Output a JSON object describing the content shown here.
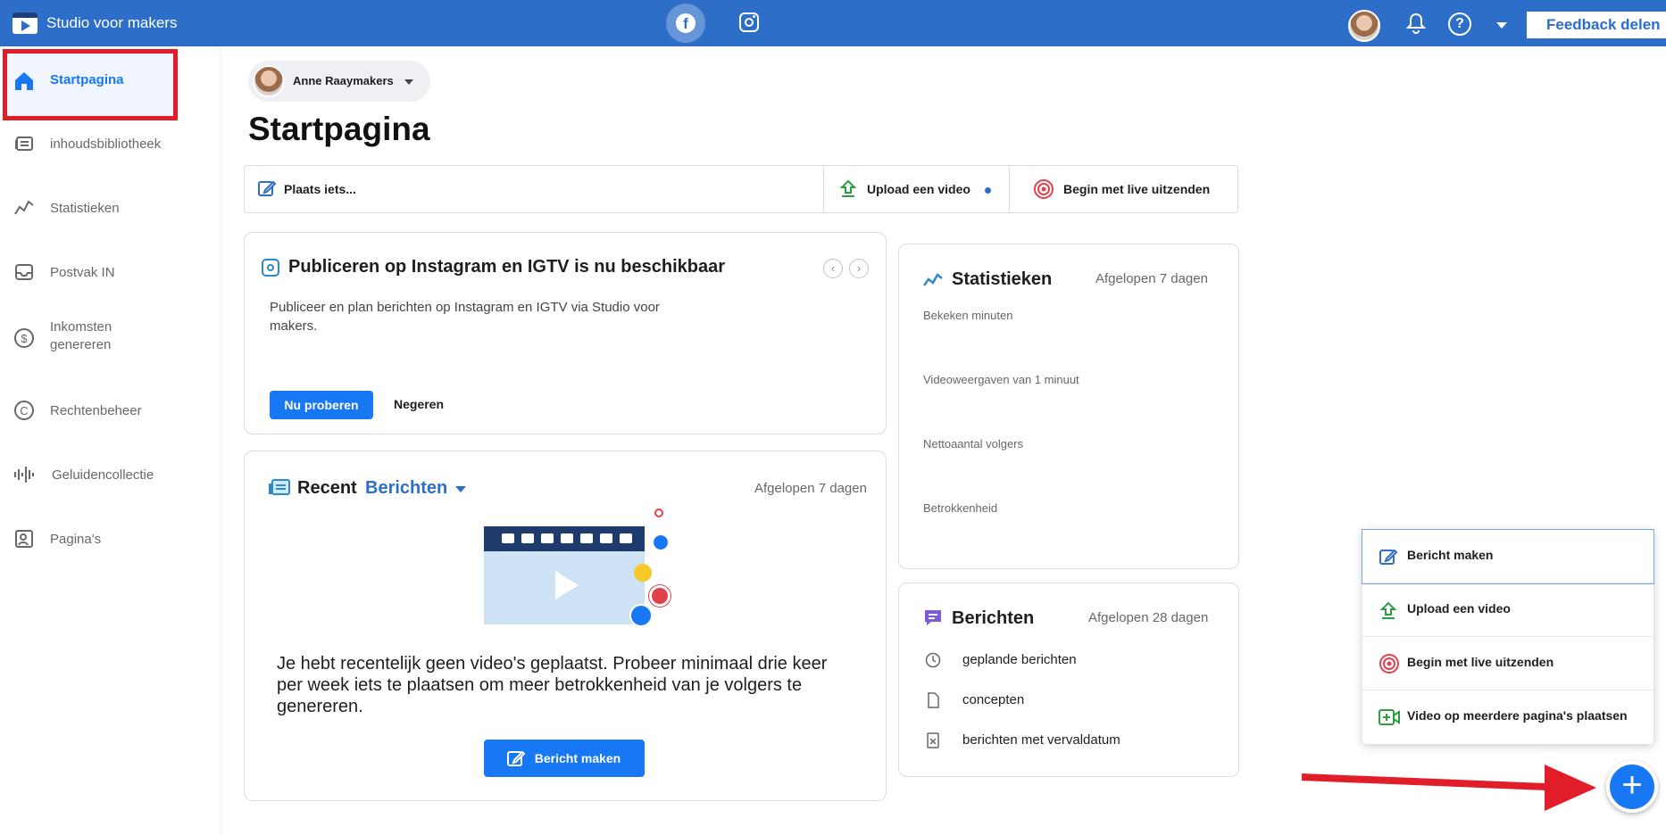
{
  "topbar": {
    "app_title": "Studio voor makers",
    "platforms": [
      "facebook",
      "instagram"
    ],
    "feedback_label": "Feedback delen"
  },
  "sidebar": {
    "items": [
      {
        "label": "Startpagina",
        "icon": "home-icon",
        "active": true
      },
      {
        "label": "inhoudsbibliotheek",
        "icon": "library-icon"
      },
      {
        "label": "Statistieken",
        "icon": "stats-icon"
      },
      {
        "label": "Postvak IN",
        "icon": "inbox-icon"
      },
      {
        "label": "Inkomsten genereren",
        "icon": "dollar-icon"
      },
      {
        "label": "Rechtenbeheer",
        "icon": "copyright-icon"
      },
      {
        "label": "Geluidencollectie",
        "icon": "sound-icon"
      },
      {
        "label": "Pagina's",
        "icon": "pages-icon"
      }
    ]
  },
  "main": {
    "page_name": "Anne Raaymakers",
    "title": "Startpagina",
    "actions": {
      "post": "Plaats iets...",
      "upload": "Upload een video",
      "live": "Begin met live uitzenden"
    },
    "instagram_card": {
      "title": "Publiceren op Instagram en IGTV is nu beschikbaar",
      "body": "Publiceer en plan berichten op Instagram en IGTV via Studio voor makers.",
      "primary": "Nu proberen",
      "secondary": "Negeren"
    },
    "recent_card": {
      "title": "Recent",
      "filter": "Berichten",
      "period": "Afgelopen 7 dagen",
      "message": "Je hebt recentelijk geen video's geplaatst. Probeer minimaal drie keer per week iets te plaatsen om meer betrokkenheid van je volgers te genereren.",
      "button": "Bericht maken"
    },
    "stats_card": {
      "title": "Statistieken",
      "period": "Afgelopen 7 dagen",
      "metrics": [
        "Bekeken minuten",
        "Videoweergaven van 1 minuut",
        "Nettoaantal volgers",
        "Betrokkenheid"
      ]
    },
    "posts_card": {
      "title": "Berichten",
      "period": "Afgelopen 28 dagen",
      "rows": [
        "geplande berichten",
        "concepten",
        "berichten met vervaldatum"
      ]
    }
  },
  "popup": {
    "items": [
      "Bericht maken",
      "Upload een video",
      "Begin met live uitzenden",
      "Video op meerdere pagina's plaatsen"
    ]
  },
  "fab": {
    "label": "+"
  },
  "colors": {
    "topbar": "#2d6ec9",
    "accent": "#1877f2",
    "highlight": "#e11d2a"
  }
}
